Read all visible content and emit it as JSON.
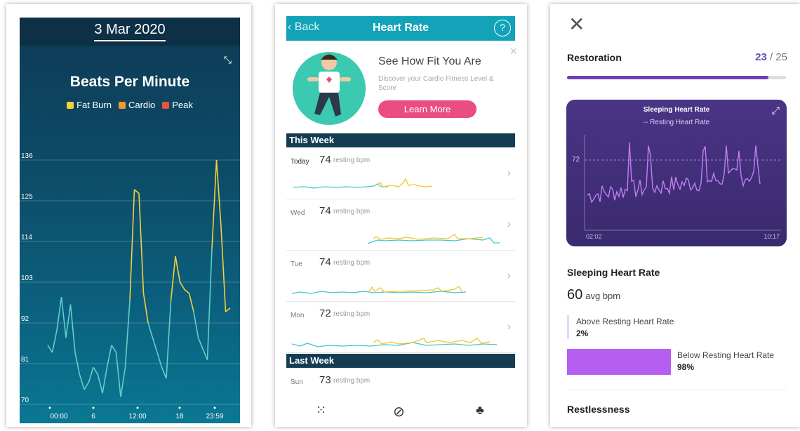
{
  "panel1": {
    "date": "3 Mar 2020",
    "title": "Beats Per Minute",
    "legend": [
      {
        "label": "Fat Burn",
        "color": "#f5d03a"
      },
      {
        "label": "Cardio",
        "color": "#f39a2e"
      },
      {
        "label": "Peak",
        "color": "#e8533a"
      }
    ],
    "collapse_icon": "collapse-arrows-icon"
  },
  "chart_data": [
    {
      "type": "line",
      "title": "Beats Per Minute",
      "yticks": [
        70,
        81,
        92,
        103,
        114,
        125,
        136
      ],
      "xticks": [
        "00:00",
        "6",
        "12:00",
        "18",
        "23:59"
      ],
      "ylim": [
        70,
        140
      ],
      "zones": {
        "fat_burn_from": 96
      },
      "x": [
        0,
        0.5,
        1,
        1.5,
        2,
        2.5,
        3,
        3.5,
        4,
        4.5,
        5,
        5.5,
        6,
        6.5,
        7,
        7.5,
        8,
        8.5,
        9,
        9.5,
        10,
        10.5,
        11,
        11.5,
        12,
        12.5,
        13,
        13.5,
        14,
        14.5,
        15,
        15.5,
        16,
        16.5,
        17,
        17.5,
        18,
        18.5,
        19,
        19.5,
        20
      ],
      "y": [
        86,
        84,
        90,
        99,
        88,
        97,
        84,
        78,
        74,
        76,
        80,
        78,
        73,
        80,
        86,
        84,
        72,
        80,
        98,
        128,
        127,
        100,
        92,
        88,
        84,
        80,
        77,
        98,
        110,
        103,
        101,
        100,
        95,
        88,
        85,
        82,
        112,
        136,
        118,
        95,
        96
      ]
    }
  ],
  "panel2": {
    "header": {
      "back": "Back",
      "title": "Heart Rate",
      "help": "?"
    },
    "promo": {
      "title": "See How Fit You Are",
      "desc": "Discover your Cardio Fitness Level & Score",
      "button": "Learn More",
      "close": "×"
    },
    "sections": [
      {
        "label": "This Week",
        "rows": [
          {
            "day": "Today",
            "bpm": "74",
            "unit": "resting bpm"
          },
          {
            "day": "Wed",
            "bpm": "74",
            "unit": "resting bpm"
          },
          {
            "day": "Tue",
            "bpm": "74",
            "unit": "resting bpm"
          },
          {
            "day": "Mon",
            "bpm": "72",
            "unit": "resting bpm"
          }
        ]
      },
      {
        "label": "Last Week",
        "rows": [
          {
            "day": "Sun",
            "bpm": "73",
            "unit": "resting bpm"
          }
        ]
      }
    ],
    "nav_icons": [
      "dashboard-dots-icon",
      "discover-compass-icon",
      "community-icon"
    ]
  },
  "panel3": {
    "section": "Restoration",
    "score": "23",
    "score_total": "/ 25",
    "score_fraction": 0.92,
    "card": {
      "title": "Sleeping Heart Rate",
      "subtitle": "-- Resting Heart Rate",
      "y_label": "72",
      "x_start": "02:02",
      "x_end": "10:17"
    },
    "shr_title": "Sleeping Heart Rate",
    "avg_value": "60",
    "avg_unit": "avg bpm",
    "above_label": "Above Resting Heart Rate",
    "above_value": "2%",
    "below_label": "Below Resting Heart Rate",
    "below_value": "98%",
    "restlessness": "Restlessness"
  }
}
